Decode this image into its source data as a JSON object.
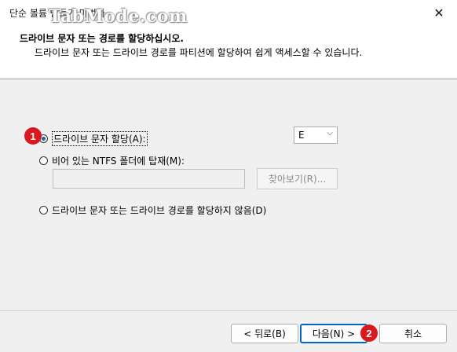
{
  "window": {
    "title": "단순 볼륨 만들기 마법사",
    "watermark": "TabMode.com",
    "close_glyph": "✕"
  },
  "header": {
    "title": "드라이브 문자 또는 경로를 할당하십시오.",
    "subtitle": "드라이브 문자 또는 드라이브 경로를 파티션에 할당하여 쉽게 액세스할 수 있습니다."
  },
  "options": {
    "assign_letter": {
      "label": "드라이브 문자 할당(A):",
      "checked": true
    },
    "mount_folder": {
      "label": "비어 있는 NTFS 폴더에 탑재(M):",
      "checked": false
    },
    "no_assign": {
      "label": "드라이브 문자 또는 드라이브 경로를 할당하지 않음(D)",
      "checked": false
    }
  },
  "drive_letter": {
    "value": "E",
    "chevron": "⌵"
  },
  "mount_path": {
    "value": ""
  },
  "browse_label": "찾아보기(R)...",
  "footer": {
    "back_label": "< 뒤로(B)",
    "next_label": "다음(N) >",
    "cancel_label": "취소"
  },
  "annotations": {
    "badge1": "1",
    "badge2": "2",
    "badge_color": "#d9191e"
  },
  "colors": {
    "accent": "#0067c0",
    "radio_fill": "#1a5fb4"
  }
}
